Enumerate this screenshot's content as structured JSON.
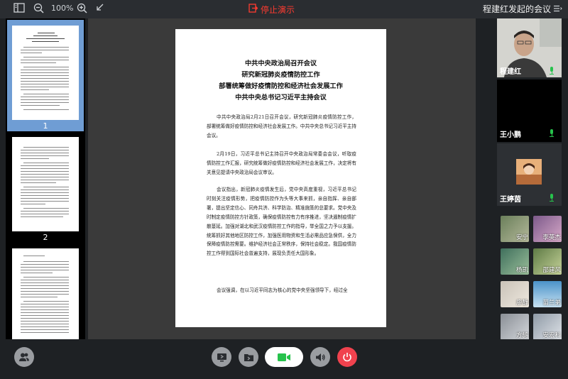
{
  "toolbar": {
    "zoom_level": "100%",
    "stop_presenting_label": "停止演示",
    "meeting_title": "程建红发起的会议",
    "icons": [
      "sidebar-toggle-icon",
      "zoom-out-icon",
      "zoom-in-icon",
      "collapse-arrow-icon",
      "stop-share-icon",
      "list-menu-icon"
    ]
  },
  "thumbnails": [
    {
      "page_number": "1",
      "active": true
    },
    {
      "page_number": "2",
      "active": false
    },
    {
      "page_number": "",
      "active": false
    }
  ],
  "document": {
    "title_lines": [
      "中共中央政治局召开会议",
      "研究新冠肺炎疫情防控工作",
      "部署统筹做好疫情防控和经济社会发展工作",
      "中共中央总书记习近平主持会议"
    ],
    "paragraphs": [
      "中共中央政治局2月21日召开会议，研究新冠肺炎疫情防控工作，部署统筹做好疫情防控和经济社会发展工作。中共中央总书记习近平主持会议。",
      "2月19日，习近平总书记主持召开中央政治局常委会会议，听取疫情防控工作汇报，研究统筹做好疫情防控和经济社会发展工作，决定将有关意见提请中央政治局会议审议。",
      "会议指出，新冠肺炎疫情发生后，党中央高度重视，习近平总书记时刻关注疫情形势，把疫情防控作为头等大事来抓，亲自指挥、亲自部署，提出坚定信心、同舟共济、科学防治、精准施策的总要求。党中央及时制定疫情防控方针政策，确保疫情防控有力有序推进，坚决遏制疫情扩散蔓延。加强对湖北和武汉疫情防控工作的指导，举全国之力予以支援。统筹抓好其他地区防控工作，加强医用物资和生活必需品应急保供，全力保障疫情防控需要。维护经济社会正常秩序，保持社会稳定。我国疫情防控工作得到国际社会普遍支持，展现负责任大国形象。",
      "会议强调，在以习近平同志为核心的党中央坚强领导下，经过全"
    ]
  },
  "participants_main": [
    {
      "name": "程建红",
      "mic": "green"
    },
    {
      "name": "王小鹏",
      "mic": "green"
    },
    {
      "name": "王婷茵",
      "mic": "green"
    }
  ],
  "participants_small": [
    {
      "name": "安宁"
    },
    {
      "name": "李英杰"
    },
    {
      "name": "杨凯"
    },
    {
      "name": "邵建风"
    },
    {
      "name": "廖静"
    },
    {
      "name": "苗兰弟"
    },
    {
      "name": "方鸫"
    },
    {
      "name": "安宏科"
    }
  ],
  "bottom_controls": [
    "participants-button",
    "share-screen-button",
    "share-file-button",
    "camera-button",
    "speaker-button",
    "end-call-button"
  ],
  "colors": {
    "accent_green": "#27c24c",
    "stop_red": "#ff3b30",
    "end_red": "#f0424e",
    "active_thumb": "#6f9dd4"
  }
}
